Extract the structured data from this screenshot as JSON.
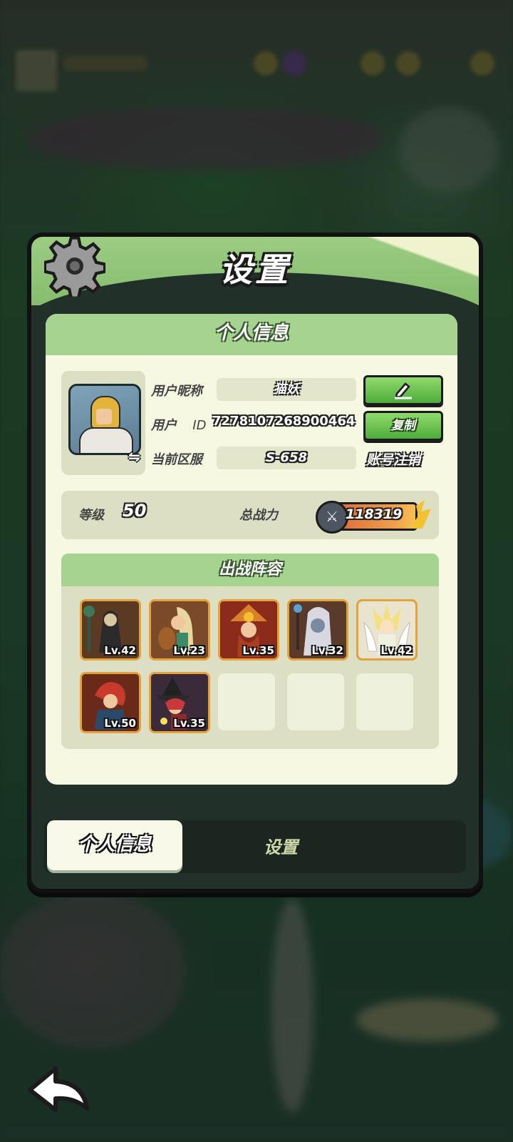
{
  "panel": {
    "title": "设置"
  },
  "profile": {
    "section_title": "个人信息",
    "nickname_label": "用户昵称",
    "nickname_value": "猫妖",
    "id_label": "用户",
    "id_label_suffix": "ID",
    "id_value": "7278107268900464",
    "server_label": "当前区服",
    "server_value": "S-658",
    "copy_label": "复制",
    "logout_label": "账号注销"
  },
  "stats": {
    "level_label": "等级",
    "level_value": "50",
    "power_label": "总战力",
    "power_value": "118319"
  },
  "lineup": {
    "title": "出战阵容",
    "heroes": [
      {
        "lv": "Lv.42"
      },
      {
        "lv": "Lv.23"
      },
      {
        "lv": "Lv.35"
      },
      {
        "lv": "Lv.32"
      },
      {
        "lv": "Lv.42"
      },
      {
        "lv": "Lv.50"
      },
      {
        "lv": "Lv.35"
      }
    ],
    "empty_slots": 3
  },
  "tabs": {
    "active": "个人信息",
    "inactive": "设置"
  },
  "colors": {
    "panel_header": "#9bcc82",
    "card_bg": "#f6f8e2",
    "button_green": "#4eac3a",
    "hero_frame": "#e3a23c"
  },
  "icons": {
    "settings": "gear-icon",
    "edit": "pencil-icon",
    "avatar_swap": "swap-icon",
    "power": "crossed-swords-icon",
    "back": "back-arrow-icon"
  }
}
